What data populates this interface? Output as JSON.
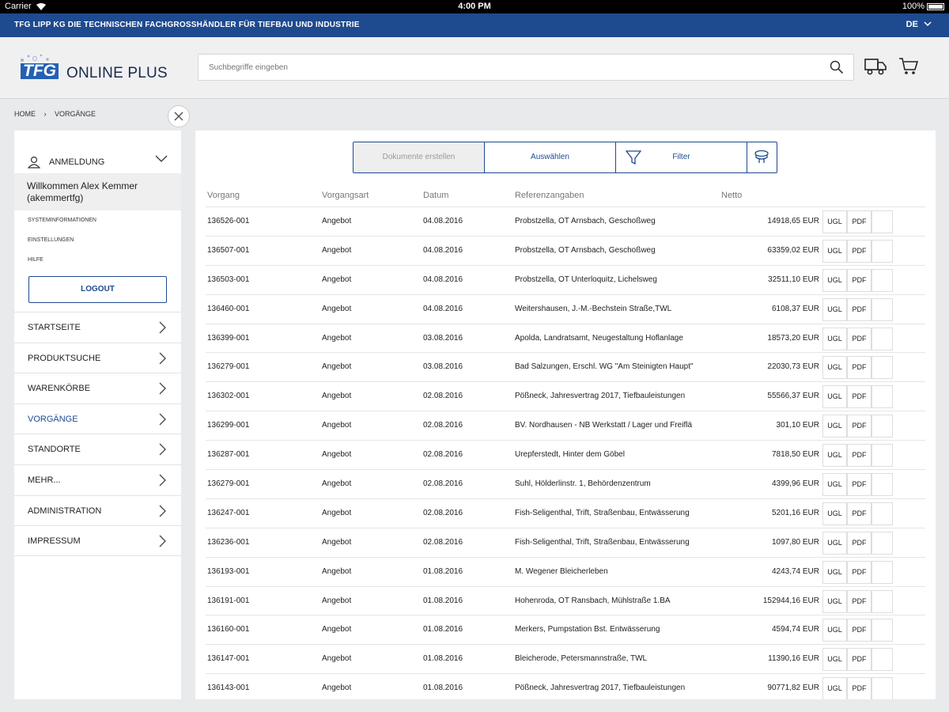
{
  "status_bar": {
    "carrier": "Carrier",
    "time": "4:00 PM",
    "battery": "100%"
  },
  "top_bar": {
    "tagline": "TFG LIPP KG DIE TECHNISCHEN FACHGROSSHÄNDLER FÜR TIEFBAU UND INDUSTRIE",
    "language": "DE"
  },
  "header": {
    "logo_short": "TFG",
    "logo_name": "ONLINE PLUS",
    "search_placeholder": "Suchbegriffe eingeben"
  },
  "breadcrumb": {
    "home": "HOME",
    "separator": "›",
    "current": "VORGÄNGE"
  },
  "sidebar": {
    "login_label": "ANMELDUNG",
    "welcome": "Willkommen Alex Kemmer (akemmertfg)",
    "links": [
      "SYSTEMINFORMATIONEN",
      "EINSTELLUNGEN",
      "HILFE"
    ],
    "logout_label": "LOGOUT",
    "nav": [
      {
        "label": "STARTSEITE",
        "active": false
      },
      {
        "label": "PRODUKTSUCHE",
        "active": false
      },
      {
        "label": "WARENKÖRBE",
        "active": false
      },
      {
        "label": "VORGÄNGE",
        "active": true
      },
      {
        "label": "STANDORTE",
        "active": false
      },
      {
        "label": "MEHR...",
        "active": false
      },
      {
        "label": "ADMINISTRATION",
        "active": false
      },
      {
        "label": "IMPRESSUM",
        "active": false
      }
    ]
  },
  "toolbar": {
    "create_docs_label": "Dokumente erstellen",
    "select_label": "Auswählen",
    "filter_label": "Filter"
  },
  "table": {
    "columns": [
      "Vorgang",
      "Vorgangsart",
      "Datum",
      "Referenzangaben",
      "Netto"
    ],
    "ugl_label": "UGL",
    "pdf_label": "PDF",
    "rows": [
      [
        "136526-001",
        "Angebot",
        "04.08.2016",
        "Probstzella, OT Arnsbach, Geschoßweg",
        "14918,65 EUR"
      ],
      [
        "136507-001",
        "Angebot",
        "04.08.2016",
        "Probstzella, OT Arnsbach, Geschoßweg",
        "63359,02 EUR"
      ],
      [
        "136503-001",
        "Angebot",
        "04.08.2016",
        "Probstzella, OT Unterloquitz, Lichelsweg",
        "32511,10 EUR"
      ],
      [
        "136460-001",
        "Angebot",
        "04.08.2016",
        "Weitershausen, J.-M.-Bechstein Straße,TWL",
        "6108,37 EUR"
      ],
      [
        "136399-001",
        "Angebot",
        "03.08.2016",
        "Apolda, Landratsamt, Neugestaltung Hoflanlage",
        "18573,20 EUR"
      ],
      [
        "136279-001",
        "Angebot",
        "03.08.2016",
        "Bad Salzungen, Erschl. WG \"Am Steinigten Haupt\"",
        "22030,73 EUR"
      ],
      [
        "136302-001",
        "Angebot",
        "02.08.2016",
        "Pößneck, Jahresvertrag 2017, Tiefbauleistungen",
        "55566,37 EUR"
      ],
      [
        "136299-001",
        "Angebot",
        "02.08.2016",
        "BV. Nordhausen - NB Werkstatt / Lager und Freiflä",
        "301,10 EUR"
      ],
      [
        "136287-001",
        "Angebot",
        "02.08.2016",
        "Urepferstedt, Hinter dem Göbel",
        "7818,50 EUR"
      ],
      [
        "136279-001",
        "Angebot",
        "02.08.2016",
        "Suhl, Hölderlinstr. 1, Behördenzentrum",
        "4399,96 EUR"
      ],
      [
        "136247-001",
        "Angebot",
        "02.08.2016",
        "Fish-Seligenthal, Trift, Straßenbau, Entwässerung",
        "5201,16 EUR"
      ],
      [
        "136236-001",
        "Angebot",
        "02.08.2016",
        "Fish-Seligenthal, Trift, Straßenbau, Entwässerung",
        "1097,80 EUR"
      ],
      [
        "136193-001",
        "Angebot",
        "01.08.2016",
        "M. Wegener Bleicherleben",
        "4243,74 EUR"
      ],
      [
        "136191-001",
        "Angebot",
        "01.08.2016",
        "Hohenroda, OT Ransbach, Mühlstraße 1.BA",
        "152944,16 EUR"
      ],
      [
        "136160-001",
        "Angebot",
        "01.08.2016",
        "Merkers, Pumpstation Bst. Entwässerung",
        "4594,74 EUR"
      ],
      [
        "136147-001",
        "Angebot",
        "01.08.2016",
        "Bleicherode, Petersmannstraße, TWL",
        "11390,16 EUR"
      ],
      [
        "136143-001",
        "Angebot",
        "01.08.2016",
        "Pößneck, Jahresvertrag 2017, Tiefbauleistungen",
        "90771,82 EUR"
      ]
    ]
  },
  "colors": {
    "brand_blue": "#1e4a8f",
    "logo_blue": "#2460b3"
  },
  "icons": [
    "wifi-icon",
    "battery-icon",
    "chevron-down-icon",
    "search-icon",
    "truck-icon",
    "cart-icon",
    "close-icon",
    "user-icon",
    "chevron-right-icon",
    "funnel-icon",
    "column-settings-icon"
  ]
}
